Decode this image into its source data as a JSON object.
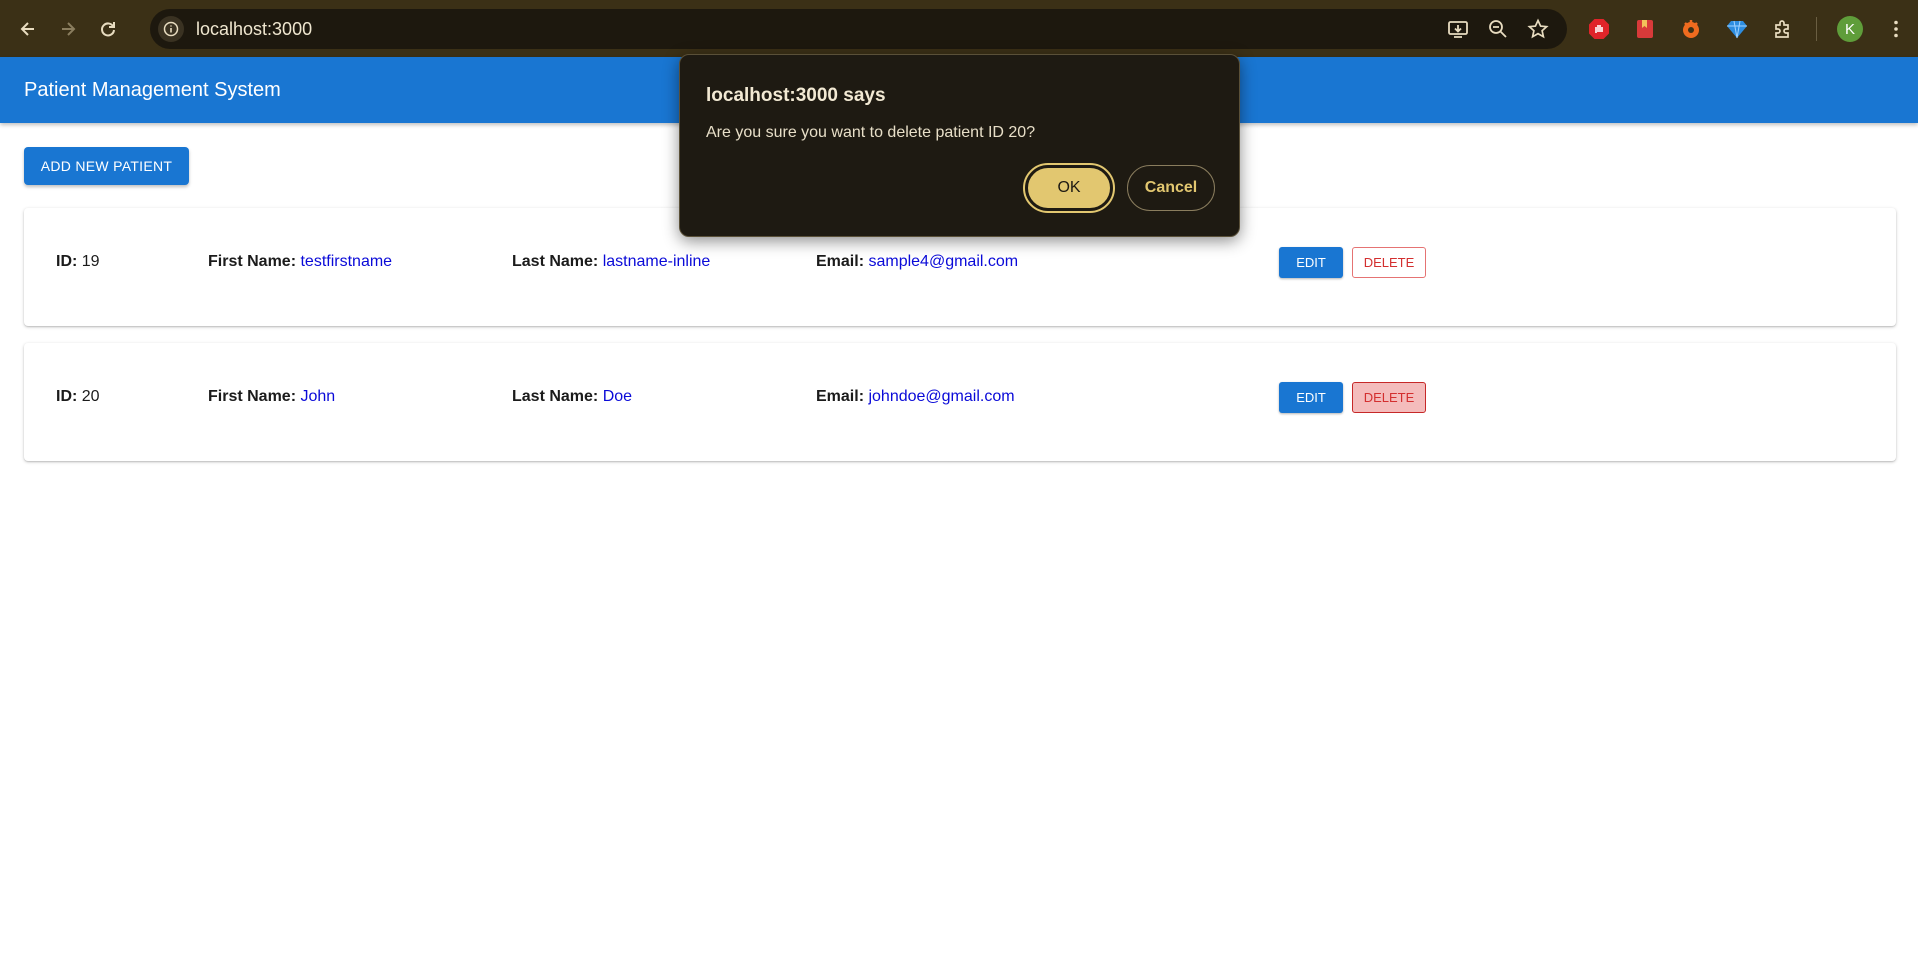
{
  "browser": {
    "url": "localhost:3000",
    "profile_initial": "K",
    "icons": {
      "back": "arrow-left-icon",
      "forward": "arrow-right-icon",
      "reload": "reload-icon",
      "site_info": "info-icon",
      "install": "install-app-icon",
      "zoom": "zoom-out-icon",
      "bookmark": "star-icon",
      "extensions": [
        "adblock-hand-icon",
        "bookmark-red-icon",
        "orange-extension-icon",
        "diamond-icon",
        "puzzle-icon"
      ],
      "menu": "kebab-menu-icon"
    }
  },
  "app": {
    "title": "Patient Management System",
    "add_button": "ADD NEW PATIENT",
    "accent_color": "#1976d2"
  },
  "patients": [
    {
      "id_label": "ID:",
      "id": "19",
      "first_label": "First Name:",
      "first_name": "testfirstname",
      "last_label": "Last Name:",
      "last_name": "lastname-inline",
      "email_label": "Email:",
      "email": "sample4@gmail.com",
      "edit_label": "EDIT",
      "delete_label": "DELETE"
    },
    {
      "id_label": "ID:",
      "id": "20",
      "first_label": "First Name:",
      "first_name": "John",
      "last_label": "Last Name:",
      "last_name": "Doe",
      "email_label": "Email:",
      "email": "johndoe@gmail.com",
      "edit_label": "EDIT",
      "delete_label": "DELETE"
    }
  ],
  "dialog": {
    "title": "localhost:3000 says",
    "message": "Are you sure you want to delete patient ID 20?",
    "ok_label": "OK",
    "cancel_label": "Cancel"
  }
}
